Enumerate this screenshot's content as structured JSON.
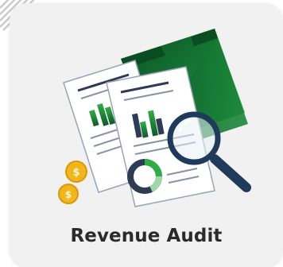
{
  "card": {
    "title": "Revenue Audit",
    "icon": "revenue-audit-illustration"
  },
  "colors": {
    "card_background": "#f1f1f1",
    "title_text": "#2b2b2b",
    "accent_green": "#1f9d3a",
    "dark_green": "#0d5c2a",
    "coin_gold": "#f2b51c",
    "magnifier_handle": "#1f3a5a",
    "document_ink": "#2e3b55"
  }
}
